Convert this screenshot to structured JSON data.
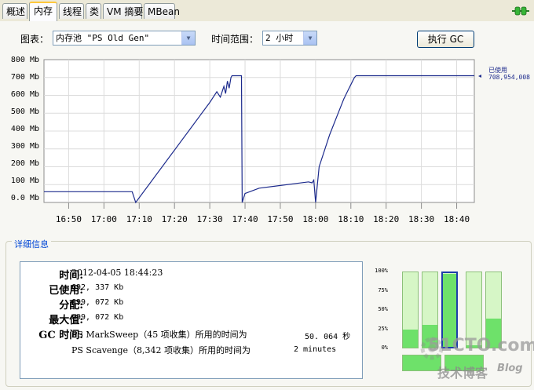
{
  "tabs": [
    {
      "label": "概述"
    },
    {
      "label": "内存"
    },
    {
      "label": "线程"
    },
    {
      "label": "类"
    },
    {
      "label": "VM 摘要"
    },
    {
      "label": "MBean"
    }
  ],
  "toolbar": {
    "chart_label": "图表：",
    "chart_value": "内存池 \"PS Old Gen\"",
    "range_label": "时间范围：",
    "range_value": "2 小时",
    "gc_button": "执行 GC"
  },
  "chart_data": {
    "type": "line",
    "title": "",
    "xlabel": "",
    "ylabel": "",
    "y_unit": "Mb",
    "ylim": [
      0,
      800
    ],
    "y_ticks": [
      "0.0 Mb",
      "100 Mb",
      "200 Mb",
      "300 Mb",
      "400 Mb",
      "500 Mb",
      "600 Mb",
      "700 Mb",
      "800 Mb"
    ],
    "x_ticks": [
      "16:50",
      "17:00",
      "17:10",
      "17:20",
      "17:30",
      "17:40",
      "17:50",
      "18:00",
      "18:10",
      "18:20",
      "18:30",
      "18:40"
    ],
    "grid": true,
    "series": [
      {
        "name": "已使用",
        "current_value": "708,954,008",
        "color": "#1c2a8c",
        "points": [
          [
            "16:43",
            60
          ],
          [
            "17:08",
            60
          ],
          [
            "17:09",
            0
          ],
          [
            "17:30",
            560
          ],
          [
            "17:32",
            620
          ],
          [
            "17:33",
            590
          ],
          [
            "17:34",
            650
          ],
          [
            "17:34.5",
            610
          ],
          [
            "17:35",
            680
          ],
          [
            "17:35.5",
            640
          ],
          [
            "17:36",
            700
          ],
          [
            "17:36.3",
            710
          ],
          [
            "17:39",
            710
          ],
          [
            "17:39.2",
            0
          ],
          [
            "17:40",
            50
          ],
          [
            "17:44",
            80
          ],
          [
            "17:50",
            95
          ],
          [
            "17:58",
            115
          ],
          [
            "17:59",
            110
          ],
          [
            "17:59.5",
            125
          ],
          [
            "18:00",
            0
          ],
          [
            "18:01",
            200
          ],
          [
            "18:04",
            380
          ],
          [
            "18:06",
            480
          ],
          [
            "18:08",
            580
          ],
          [
            "18:09",
            620
          ],
          [
            "18:10",
            660
          ],
          [
            "18:11",
            700
          ],
          [
            "18:11.5",
            710
          ],
          [
            "18:45",
            710
          ]
        ]
      }
    ]
  },
  "details": {
    "section_title": "详细信息",
    "time_label": "时间:",
    "time_value": "2012-04-05 18:44:23",
    "used_label": "已使用:",
    "used_value": "692, 337 Kb",
    "committed_label": "分配:",
    "committed_value": "699, 072 Kb",
    "max_label": "最大值:",
    "max_value": "699, 072 Kb",
    "gc_label": "GC 时间:",
    "gc1_text": "PS MarkSweep（45 项收集）所用的时间为",
    "gc1_time": "50. 064 秒",
    "gc2_text": "PS Scavenge（8,342 项收集）所用的时间为",
    "gc2_time": "2 minutes"
  },
  "pool_bars": {
    "scale": [
      "100%",
      "75%",
      "50%",
      "25%",
      "0%"
    ],
    "heap_levels": [
      0.24,
      0.3,
      0.99,
      0.03,
      0.39
    ],
    "heap_selected_index": 2,
    "nonheap_levels": [
      1.0,
      1.0
    ]
  },
  "watermark": {
    "line1": "51CTO.com",
    "line2": "技术博客",
    "line3": "Blog"
  },
  "colors": {
    "series_line": "#1c2a8c",
    "tab_accent": "#ffc83c",
    "group_title": "#0046d5",
    "bar_fill": "#6ee16a",
    "bar_empty": "#d6f6c6"
  }
}
